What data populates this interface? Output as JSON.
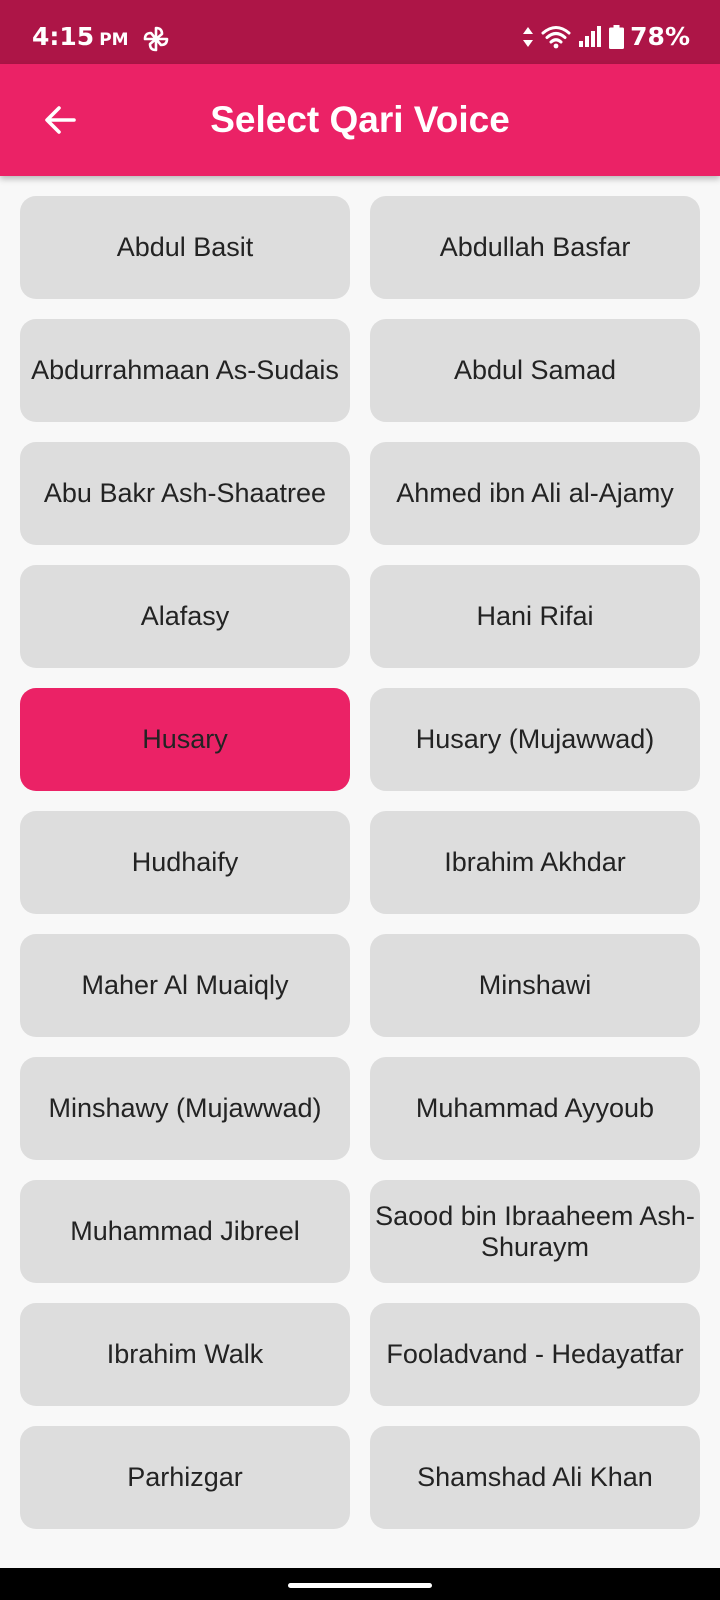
{
  "status_bar": {
    "time": "4:15",
    "ampm": "PM",
    "battery": "78%",
    "icons": [
      "pinwheel-icon",
      "data-arrows-icon",
      "wifi-icon",
      "signal-icon",
      "battery-icon"
    ]
  },
  "app_bar": {
    "title": "Select Qari Voice",
    "back_icon": "arrow-back-icon"
  },
  "colors": {
    "accent": "#eb2266",
    "status_bar": "#ad1547",
    "button": "#dddddd",
    "background": "#f8f8f8"
  },
  "selected": "Husary",
  "qaris": [
    "Abdul Basit",
    "Abdullah Basfar",
    "Abdurrahmaan As-Sudais",
    "Abdul Samad",
    "Abu Bakr Ash-Shaatree",
    "Ahmed ibn Ali al-Ajamy",
    "Alafasy",
    "Hani Rifai",
    "Husary",
    "Husary (Mujawwad)",
    "Hudhaify",
    "Ibrahim Akhdar",
    "Maher Al Muaiqly",
    "Minshawi",
    "Minshawy (Mujawwad)",
    "Muhammad Ayyoub",
    "Muhammad Jibreel",
    "Saood bin Ibraaheem Ash-Shuraym",
    "Ibrahim Walk",
    "Fooladvand - Hedayatfar",
    "Parhizgar",
    "Shamshad Ali Khan"
  ]
}
